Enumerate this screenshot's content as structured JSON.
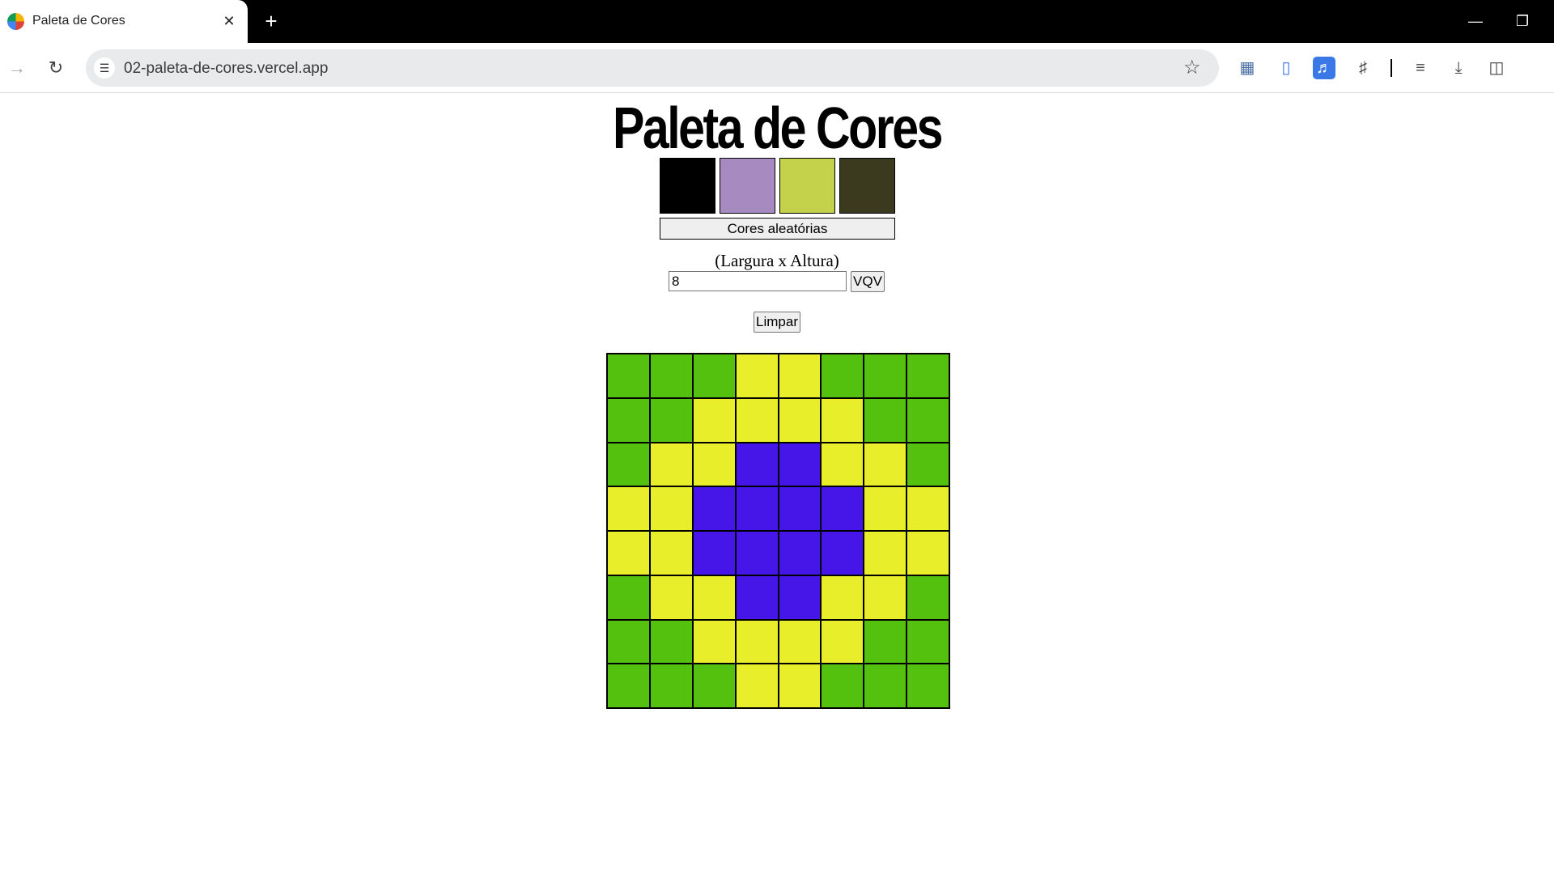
{
  "browser": {
    "tab_title": "Paleta de Cores",
    "tab_close": "✕",
    "new_tab": "+",
    "url": "02-paleta-de-cores.vercel.app"
  },
  "app": {
    "title": "Paleta de Cores",
    "palette": [
      "#000000",
      "#a78ac0",
      "#c4d14a",
      "#3c3a1e"
    ],
    "random_button_label": "Cores aleatórias",
    "size_label": "(Largura x Altura)",
    "board_size_value": "8",
    "vqv_button_label": "VQV",
    "clear_button_label": "Limpar"
  },
  "colors": {
    "G": "#53c10e",
    "Y": "#e8ee2a",
    "B": "#4616e8"
  },
  "board": [
    [
      "G",
      "G",
      "G",
      "Y",
      "Y",
      "G",
      "G",
      "G"
    ],
    [
      "G",
      "G",
      "Y",
      "Y",
      "Y",
      "Y",
      "G",
      "G"
    ],
    [
      "G",
      "Y",
      "Y",
      "B",
      "B",
      "Y",
      "Y",
      "G"
    ],
    [
      "Y",
      "Y",
      "B",
      "B",
      "B",
      "B",
      "Y",
      "Y"
    ],
    [
      "Y",
      "Y",
      "B",
      "B",
      "B",
      "B",
      "Y",
      "Y"
    ],
    [
      "G",
      "Y",
      "Y",
      "B",
      "B",
      "Y",
      "Y",
      "G"
    ],
    [
      "G",
      "G",
      "Y",
      "Y",
      "Y",
      "Y",
      "G",
      "G"
    ],
    [
      "G",
      "G",
      "G",
      "Y",
      "Y",
      "G",
      "G",
      "G"
    ]
  ]
}
